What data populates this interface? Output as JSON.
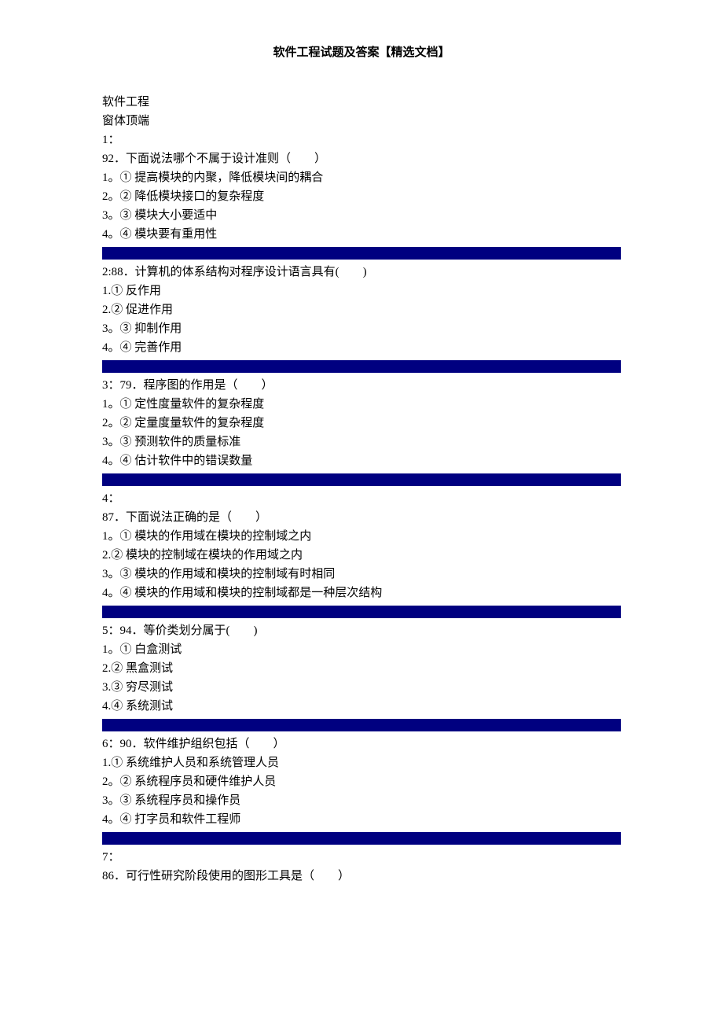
{
  "title": "软件工程试题及答案【精选文档】",
  "subject": "软件工程",
  "preamble": "窗体顶端",
  "questions": [
    {
      "index": "1：",
      "stem": "92．下面说法哪个不属于设计准则（　　）",
      "options": [
        "1。① 提高模块的内聚，降低模块间的耦合",
        "2。② 降低模块接口的复杂程度",
        "3。③ 模块大小要适中",
        "4。④ 模块要有重用性"
      ]
    },
    {
      "index": "2:",
      "stem": "88．计算机的体系结构对程序设计语言具有(　　)",
      "options": [
        "1.① 反作用",
        "2.② 促进作用",
        "3。③ 抑制作用",
        "4。④ 完善作用"
      ],
      "inline": true
    },
    {
      "index": "3：",
      "stem": "79．程序图的作用是（　　）",
      "options": [
        "1。① 定性度量软件的复杂程度",
        "2。② 定量度量软件的复杂程度",
        "3。③ 预测软件的质量标准",
        "4。④ 估计软件中的错误数量"
      ],
      "inline": true
    },
    {
      "index": "4：",
      "stem": "87．下面说法正确的是（　　）",
      "options": [
        "1。① 模块的作用域在模块的控制域之内",
        "2.② 模块的控制域在模块的作用域之内",
        "3。③ 模块的作用域和模块的控制域有时相同",
        "4。④ 模块的作用域和模块的控制域都是一种层次结构"
      ]
    },
    {
      "index": "5：",
      "stem": "94．等价类划分属于(　　)",
      "options": [
        "1。① 白盒测试",
        "2.② 黑盒测试",
        "3.③ 穷尽测试",
        "4.④ 系统测试"
      ],
      "inline": true
    },
    {
      "index": "6：",
      "stem": "90．软件维护组织包括（　　）",
      "options": [
        "1.① 系统维护人员和系统管理人员",
        "2。② 系统程序员和硬件维护人员",
        "3。③ 系统程序员和操作员",
        "4。④ 打字员和软件工程师"
      ],
      "inline": true
    },
    {
      "index": "7：",
      "stem": "86．可行性研究阶段使用的图形工具是（　　）",
      "options": []
    }
  ]
}
